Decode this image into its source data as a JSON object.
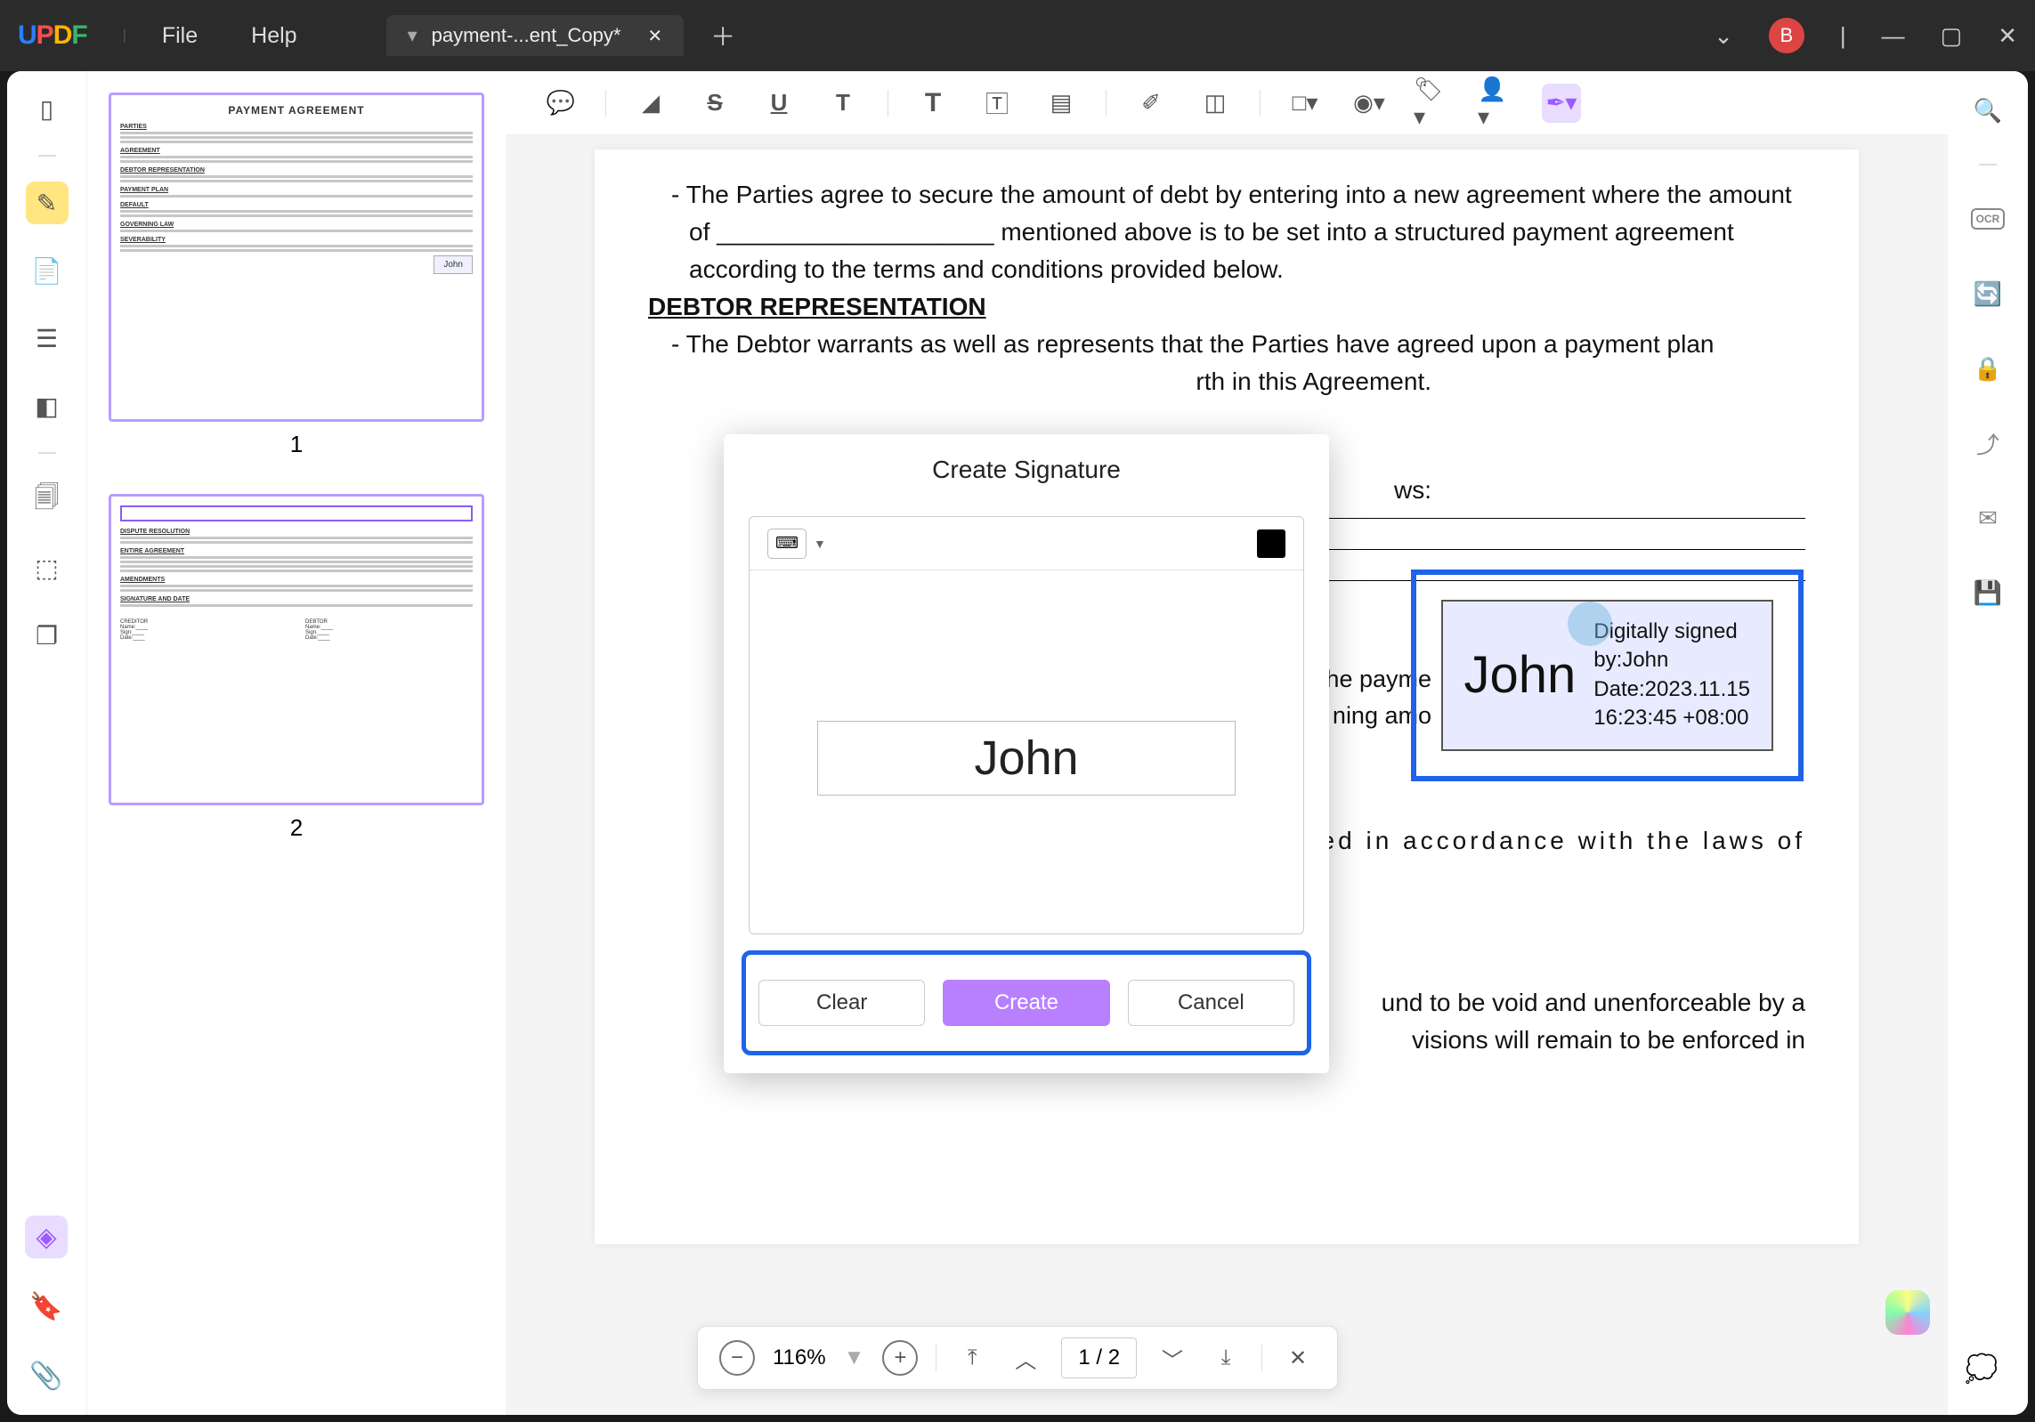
{
  "app": {
    "logo": "UPDF"
  },
  "menu": {
    "file": "File",
    "help": "Help"
  },
  "tab": {
    "title": "payment-...ent_Copy*"
  },
  "thumbs": {
    "page1_title": "PAYMENT AGREEMENT",
    "page1_sig": "John",
    "num1": "1",
    "num2": "2"
  },
  "document": {
    "p1": "-    The Parties agree to secure the amount of debt by entering into a new agreement where the amount of ____________________ mentioned above is to be set into a structured payment agreement according to the terms and conditions provided below.",
    "h1": "DEBTOR REPRESENTATION",
    "p2": "-    The Debtor warrants as well as represents that the Parties have agreed upon a payment plan",
    "p2b": "rth in this Agreement.",
    "frag1": "ws:",
    "frag2": "he payme",
    "frag3": "ning amo",
    "p3": "ed  in  accordance  with  the  laws  of",
    "p4a": "und to be void and unenforceable by a",
    "p4b": "visions will remain to be enforced in"
  },
  "signature_stamp": {
    "name": "John",
    "line1": "Digitally signed",
    "line2": "by:John",
    "line3": "Date:2023.11.15",
    "line4": "16:23:45 +08:00"
  },
  "modal": {
    "title": "Create Signature",
    "input_value": "John",
    "clear": "Clear",
    "create": "Create",
    "cancel": "Cancel"
  },
  "pager": {
    "zoom": "116%",
    "pages": "1 / 2"
  },
  "avatar": "B",
  "right_rail": {
    "ocr": "OCR"
  }
}
